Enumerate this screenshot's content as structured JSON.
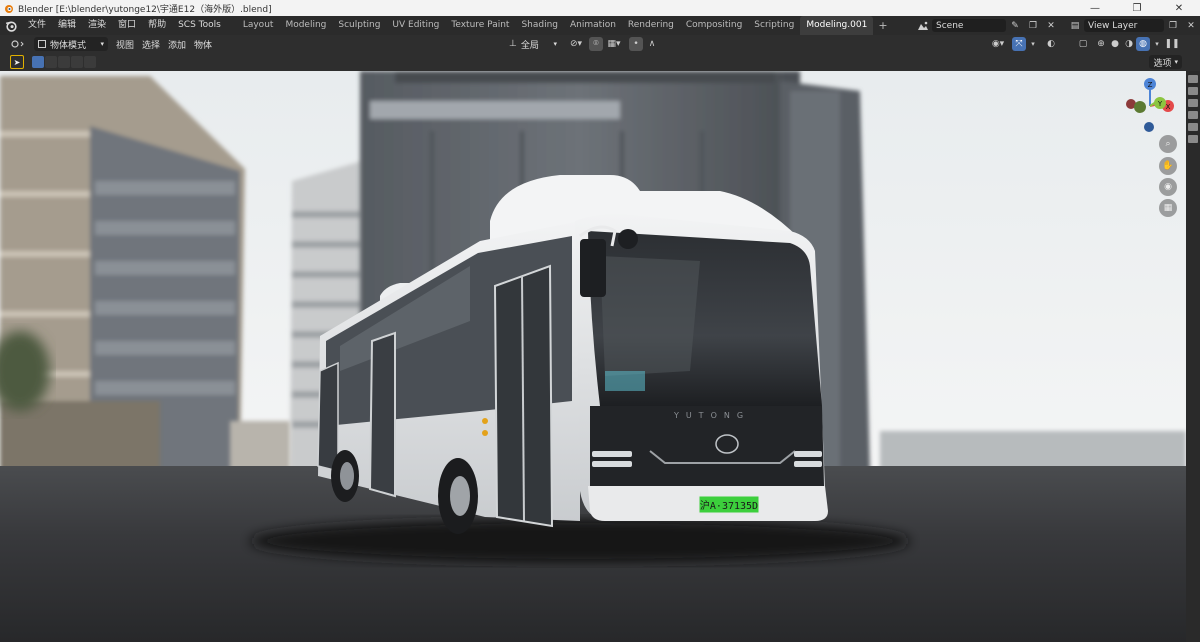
{
  "window": {
    "title": "Blender [E:\\blender\\yutonge12\\宇通E12（海外版）.blend]",
    "minimize": "—",
    "maximize": "❐",
    "close": "✕"
  },
  "menus": [
    "文件",
    "编辑",
    "渲染",
    "窗口",
    "帮助",
    "SCS Tools"
  ],
  "workspaces": [
    "Layout",
    "Modeling",
    "Sculpting",
    "UV Editing",
    "Texture Paint",
    "Shading",
    "Animation",
    "Rendering",
    "Compositing",
    "Scripting",
    "Modeling.001"
  ],
  "active_workspace": "Modeling.001",
  "scene": {
    "label": "Scene"
  },
  "view_layer": {
    "label": "View Layer"
  },
  "viewport_header": {
    "mode": "物体模式",
    "menus": [
      "视图",
      "选择",
      "添加",
      "物体"
    ],
    "orientation": "全局"
  },
  "tool_header": {
    "options_label": "选项"
  },
  "gizmo": {
    "x": "X",
    "y": "Y",
    "z": "Z"
  },
  "bus": {
    "brand": "YUTONG",
    "plate": "沪A·37135D"
  },
  "colors": {
    "accent_blue": "#4772b3",
    "plate_green": "#3ccf3c",
    "gizmo_x": "#e44a4a",
    "gizmo_y": "#8cc540",
    "gizmo_z": "#4d84d6"
  }
}
